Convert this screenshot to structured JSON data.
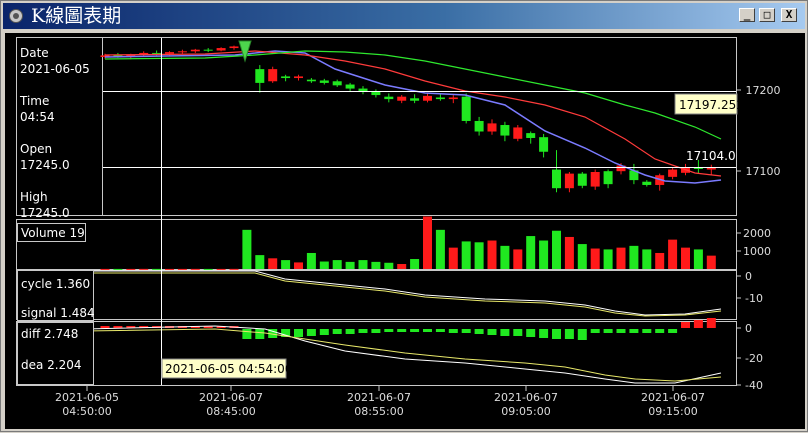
{
  "window": {
    "title": "K線圖表期",
    "minimize": "_",
    "maximize": "□",
    "close": "X"
  },
  "info": {
    "date_label": "Date",
    "date": "2021-06-05",
    "time_label": "Time",
    "time": "04:54",
    "open_label": "Open",
    "open": "17245.0",
    "high_label": "High",
    "high": "17245.0"
  },
  "crosshair": {
    "time_label": "2021-06-05 04:54:00",
    "price_label": "17197.252"
  },
  "last_price_label": "17104.0",
  "chart_data": [
    {
      "type": "candlestick",
      "y_ticks": [
        "17200",
        "17100"
      ],
      "x_tick_labels": [
        {
          "date": "2021-06-05",
          "time": "04:50:00"
        },
        {
          "date": "2021-06-07",
          "time": "08:45:00"
        },
        {
          "date": "2021-06-07",
          "time": "08:55:00"
        },
        {
          "date": "2021-06-07",
          "time": "09:05:00"
        },
        {
          "date": "2021-06-07",
          "time": "09:15:00"
        }
      ],
      "candles": [
        [
          17242,
          17246,
          17240,
          17244
        ],
        [
          17244,
          17247,
          17241,
          17242
        ],
        [
          17242,
          17246,
          17239,
          17245
        ],
        [
          17245,
          17249,
          17243,
          17247
        ],
        [
          17247,
          17250,
          17244,
          17246
        ],
        [
          17246,
          17249,
          17244,
          17248
        ],
        [
          17248,
          17251,
          17246,
          17249
        ],
        [
          17249,
          17252,
          17247,
          17251
        ],
        [
          17251,
          17253,
          17248,
          17250
        ],
        [
          17250,
          17254,
          17249,
          17253
        ],
        [
          17253,
          17256,
          17251,
          17255
        ],
        [
          17245,
          17245,
          17245,
          17245
        ],
        [
          17227,
          17232,
          17198,
          17210
        ],
        [
          17212,
          17230,
          17210,
          17227
        ],
        [
          17218,
          17220,
          17212,
          17216
        ],
        [
          17216,
          17220,
          17213,
          17218
        ],
        [
          17214,
          17216,
          17210,
          17212
        ],
        [
          17213,
          17215,
          17208,
          17210
        ],
        [
          17212,
          17214,
          17205,
          17207
        ],
        [
          17208,
          17210,
          17200,
          17203
        ],
        [
          17203,
          17206,
          17196,
          17200
        ],
        [
          17200,
          17202,
          17192,
          17195
        ],
        [
          17193,
          17197,
          17186,
          17190
        ],
        [
          17188,
          17195,
          17185,
          17193
        ],
        [
          17191,
          17196,
          17185,
          17188
        ],
        [
          17188,
          17197,
          17186,
          17194
        ],
        [
          17192,
          17197,
          17188,
          17190
        ],
        [
          17190,
          17195,
          17185,
          17192
        ],
        [
          17193,
          17197,
          17160,
          17163
        ],
        [
          17163,
          17168,
          17145,
          17150
        ],
        [
          17150,
          17165,
          17146,
          17160
        ],
        [
          17158,
          17162,
          17138,
          17145
        ],
        [
          17141,
          17158,
          17138,
          17155
        ],
        [
          17148,
          17150,
          17135,
          17142
        ],
        [
          17143,
          17147,
          17118,
          17125
        ],
        [
          17103,
          17127,
          17075,
          17080
        ],
        [
          17080,
          17100,
          17075,
          17098
        ],
        [
          17098,
          17100,
          17080,
          17083
        ],
        [
          17082,
          17103,
          17078,
          17100
        ],
        [
          17101,
          17103,
          17080,
          17085
        ],
        [
          17101,
          17111,
          17097,
          17108
        ],
        [
          17102,
          17110,
          17085,
          17090
        ],
        [
          17088,
          17090,
          17082,
          17084
        ],
        [
          17084,
          17098,
          17077,
          17096
        ],
        [
          17094,
          17106,
          17091,
          17103
        ],
        [
          17099,
          17110,
          17096,
          17106
        ],
        [
          17105,
          17115,
          17098,
          17104
        ],
        [
          17103,
          17109,
          17096,
          17105
        ]
      ],
      "volume": [
        5,
        5,
        6,
        8,
        6,
        5,
        6,
        7,
        5,
        6,
        8,
        2200,
        780,
        600,
        500,
        370,
        900,
        420,
        500,
        400,
        500,
        400,
        350,
        280,
        560,
        2950,
        2200,
        1200,
        1550,
        1500,
        1600,
        1300,
        1100,
        1850,
        1600,
        2150,
        1800,
        1400,
        1150,
        1100,
        1200,
        1300,
        1100,
        900,
        1650,
        1200,
        1100,
        750
      ],
      "volume_ticks": [
        "2000",
        "1000"
      ],
      "volume_label": "Volume 19",
      "cycle_ticks": [
        "0",
        "-10"
      ],
      "cycle_label": "cycle 1.360",
      "signal_label": "signal 1.484",
      "macd_ticks": [
        "0",
        "-20",
        "-40"
      ],
      "diff_label": "diff 2.748",
      "dea_label": "dea 2.204"
    }
  ]
}
